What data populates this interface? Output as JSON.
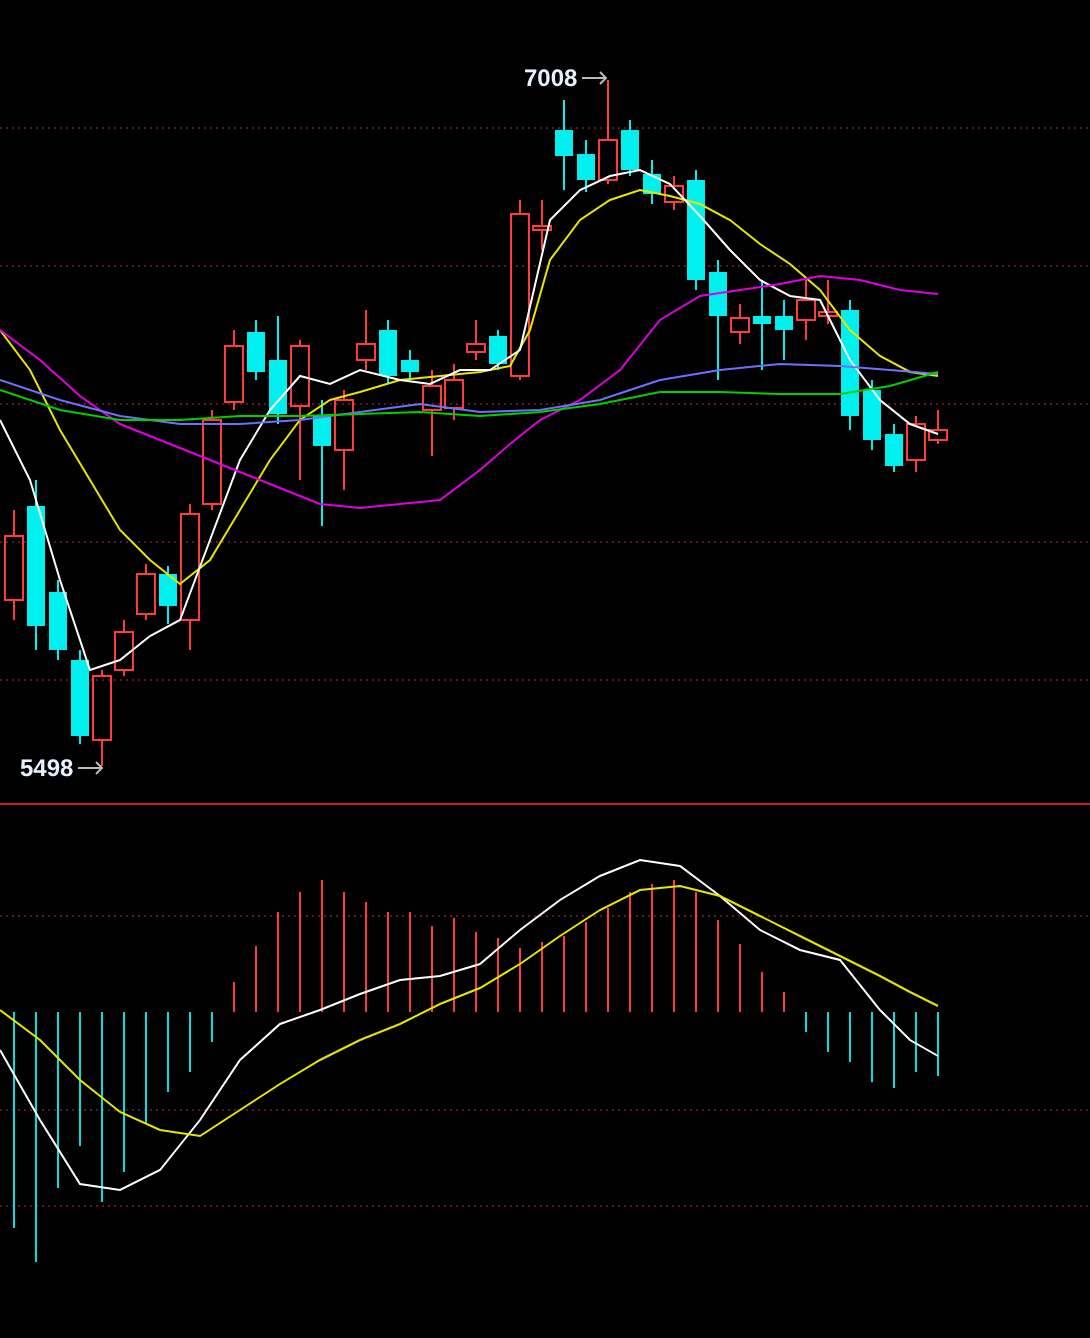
{
  "price_chart": {
    "high_label": "7008",
    "low_label": "5498"
  }
}
